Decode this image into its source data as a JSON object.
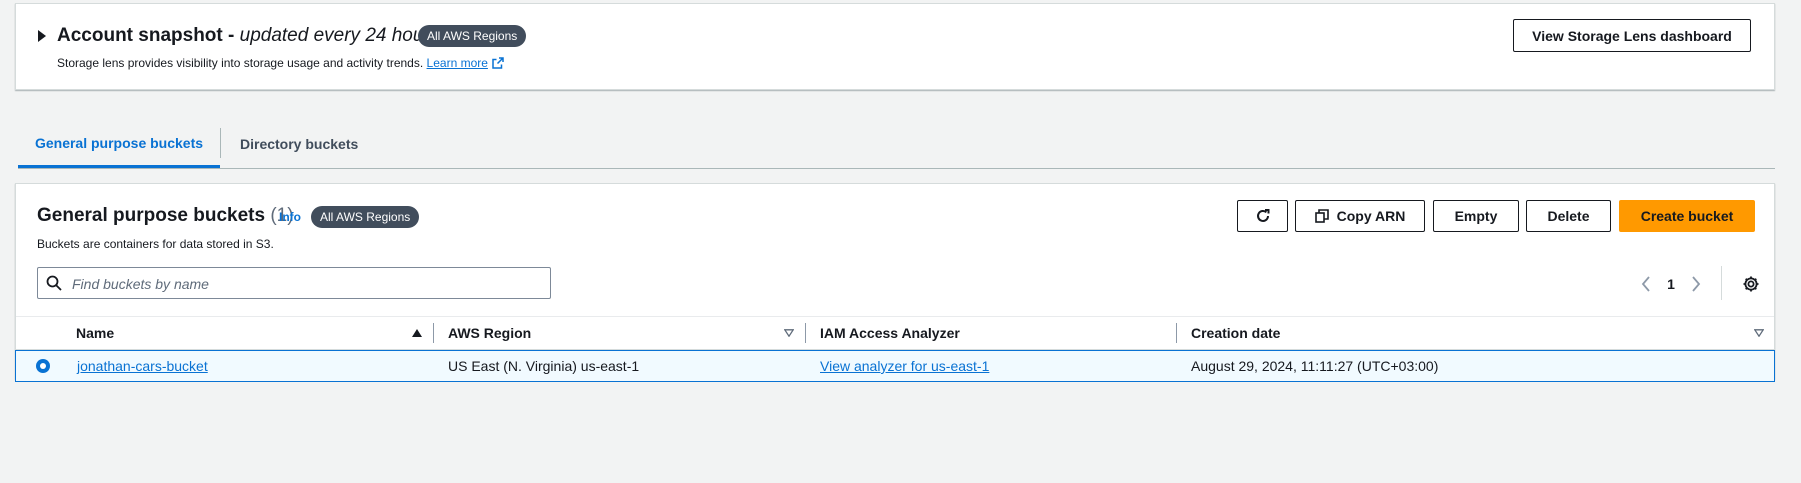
{
  "snapshot": {
    "title": "Account snapshot -",
    "title_italic": "updated every 24 hours",
    "badge": "All AWS Regions",
    "description": "Storage lens provides visibility into storage usage and activity trends.",
    "learn_more": "Learn more",
    "dashboard_button": "View Storage Lens dashboard"
  },
  "tabs": [
    {
      "label": "General purpose buckets",
      "selected": true
    },
    {
      "label": "Directory buckets",
      "selected": false
    }
  ],
  "buckets": {
    "title": "General purpose buckets",
    "count": "(1)",
    "info": "Info",
    "badge": "All AWS Regions",
    "description": "Buckets are containers for data stored in S3.",
    "actions": {
      "copy_arn": "Copy ARN",
      "empty": "Empty",
      "delete": "Delete",
      "create": "Create bucket"
    },
    "search_placeholder": "Find buckets by name",
    "page": "1",
    "columns": [
      "Name",
      "AWS Region",
      "IAM Access Analyzer",
      "Creation date"
    ],
    "rows": [
      {
        "name": "jonathan-cars-bucket",
        "region": "US East (N. Virginia) us-east-1",
        "analyzer": "View analyzer for us-east-1",
        "created": "August 29, 2024, 11:11:27 (UTC+03:00)",
        "selected": true
      }
    ]
  },
  "colors": {
    "primary": "#0972d3",
    "create_button": "#ff9900",
    "badge": "#414d5c",
    "background": "#f2f3f3"
  }
}
